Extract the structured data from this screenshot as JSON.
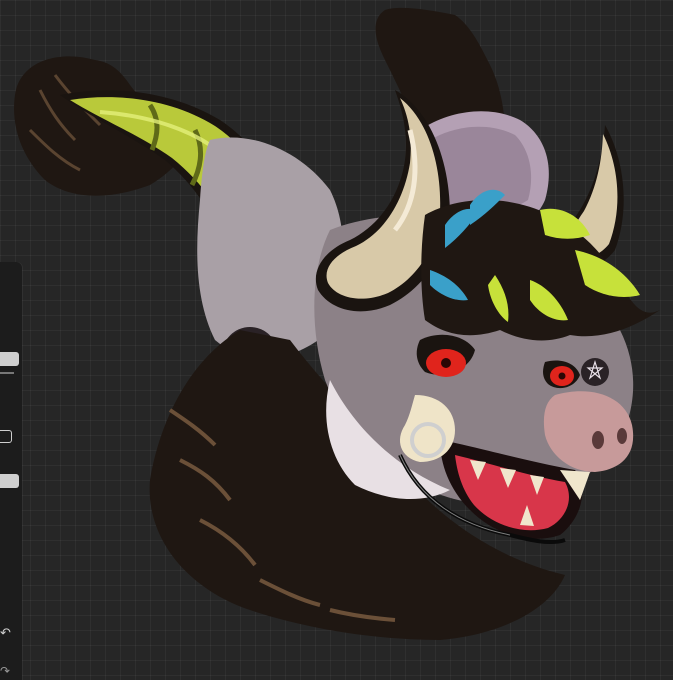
{
  "app": {
    "canvas": {
      "artwork": "character-headshot",
      "background_color": "#262626",
      "grid": true
    },
    "toolbar": {
      "undo_icon": "undo-icon",
      "redo_icon": "redo-icon",
      "modify_icon": "square-icon"
    },
    "palette": {
      "horn_large": "#b9c93a",
      "horn_small": "#d8c9a8",
      "fur_dark": "#1e1712",
      "face_grey": "#8c8187",
      "eye": "#e0241c",
      "snout": "#c79a9a",
      "hair_highlight_green": "#c7e13a",
      "hair_highlight_blue": "#3aa0c9"
    }
  }
}
